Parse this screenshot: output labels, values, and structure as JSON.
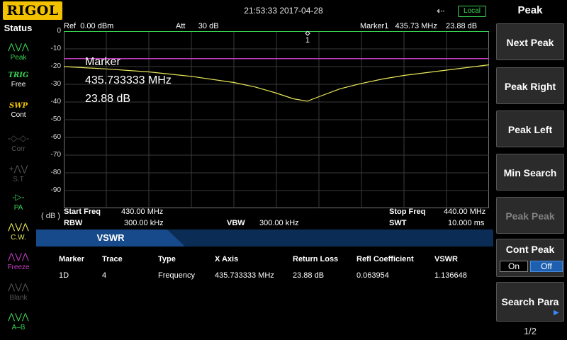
{
  "brand": "RIGOL",
  "datetime": "21:53:33 2017-04-28",
  "local_label": "Local",
  "status": {
    "title": "Status",
    "items": [
      {
        "label": "Peak",
        "icon": "peak-icon",
        "active": true
      },
      {
        "label": "TRIG",
        "label2": "Free",
        "icon": "trig-icon",
        "active": true
      },
      {
        "label": "SWP",
        "label2": "Cont",
        "icon": "sweep-icon",
        "active": true
      },
      {
        "label": "Corr",
        "icon": "corr-icon",
        "active": false
      },
      {
        "label": "S.T",
        "icon": "st-icon",
        "active": false
      },
      {
        "label": "PA",
        "icon": "pa-icon",
        "active": true
      },
      {
        "label": "C.W.",
        "icon": "cw-icon",
        "active": true
      },
      {
        "label": "Freeze",
        "icon": "freeze-icon",
        "active": true
      },
      {
        "label": "Blank",
        "icon": "blank-icon",
        "active": false
      },
      {
        "label": "A–B",
        "icon": "a-minus-b-icon",
        "active": true
      }
    ]
  },
  "header": {
    "ref": "Ref  0.00 dBm",
    "att": "Att      30 dB",
    "marker": "Marker1   435.73 MHz    23.88 dB"
  },
  "marker_box": {
    "title": "Marker",
    "freq": "435.733333 MHz",
    "value": "23.88 dB",
    "label": "1"
  },
  "chart_data": {
    "type": "line",
    "y_unit": "( dB )",
    "yticks": [
      "0",
      "-10",
      "-20",
      "-30",
      "-40",
      "-50",
      "-60",
      "-70",
      "-80",
      "-90"
    ],
    "ylim": [
      -100,
      0
    ],
    "xlim": [
      430.0,
      440.0
    ],
    "grid": true,
    "series": [
      {
        "color": "#c23cc2",
        "x": [
          430.0,
          440.0
        ],
        "y": [
          -15.5,
          -15.5
        ]
      },
      {
        "color": "#e8e85a",
        "x": [
          430.0,
          431.0,
          432.0,
          433.0,
          434.0,
          434.5,
          435.0,
          435.4,
          435.73,
          436.0,
          436.5,
          437.0,
          437.5,
          438.0,
          439.0,
          440.0
        ],
        "y": [
          -20.0,
          -21.3,
          -23.0,
          -25.5,
          -29.0,
          -31.5,
          -35.0,
          -38.2,
          -39.5,
          -37.0,
          -32.5,
          -29.5,
          -27.0,
          -25.0,
          -22.0,
          -19.0
        ]
      }
    ]
  },
  "footer": {
    "start_label": "Start Freq",
    "start_value": "430.00 MHz",
    "stop_label": "Stop Freq",
    "stop_value": "440.00 MHz",
    "rbw_label": "RBW",
    "rbw_value": "300.00 kHz",
    "vbw_label": "VBW",
    "vbw_value": "300.00 kHz",
    "swt_label": "SWT",
    "swt_value": "10.000 ms"
  },
  "panel": {
    "tab": "VSWR",
    "columns": [
      "Marker",
      "Trace",
      "Type",
      "X Axis",
      "Return Loss",
      "Refl Coefficient",
      "VSWR"
    ],
    "rows": [
      [
        "1D",
        "4",
        "Frequency",
        "435.733333 MHz",
        "23.88 dB",
        "0.063954",
        "1.136648"
      ]
    ]
  },
  "menu": {
    "title": "Peak",
    "buttons": [
      {
        "label": "Next Peak",
        "enabled": true
      },
      {
        "label": "Peak Right",
        "enabled": true
      },
      {
        "label": "Peak Left",
        "enabled": true
      },
      {
        "label": "Min Search",
        "enabled": true
      },
      {
        "label": "Peak Peak",
        "enabled": false
      }
    ],
    "cont_peak": {
      "label": "Cont Peak",
      "on": "On",
      "off": "Off",
      "selected": "Off"
    },
    "search_para": "Search Para",
    "page": "1/2"
  }
}
